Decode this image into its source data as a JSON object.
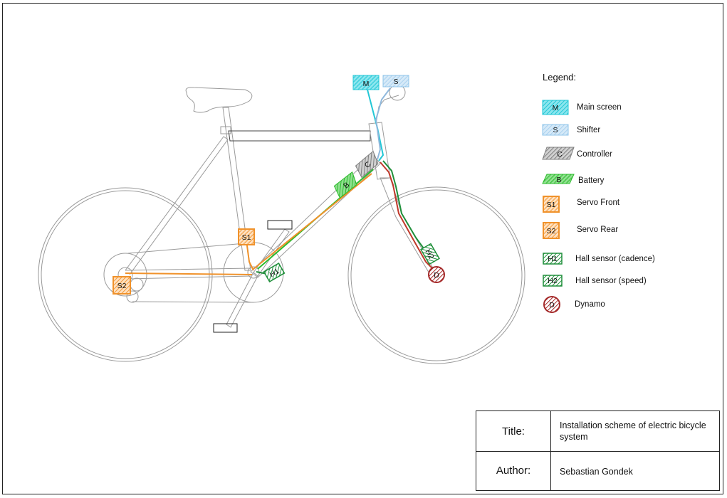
{
  "legend": {
    "title": "Legend:",
    "items": [
      {
        "code": "M",
        "label": "Main screen"
      },
      {
        "code": "S",
        "label": "Shifter"
      },
      {
        "code": "C",
        "label": "Controller"
      },
      {
        "code": "B",
        "label": "Battery"
      },
      {
        "code": "S1",
        "label": "Servo Front"
      },
      {
        "code": "S2",
        "label": "Servo Rear"
      },
      {
        "code": "H1",
        "label": "Hall sensor  (cadence)"
      },
      {
        "code": "H2",
        "label": "Hall sensor (speed)"
      },
      {
        "code": "D",
        "label": "Dynamo"
      }
    ]
  },
  "title_block": {
    "title_key": "Title:",
    "title_value": "Installation scheme of electric bicycle system",
    "author_key": "Author:",
    "author_value": "Sebastian Gondek"
  },
  "tags": {
    "main_screen": "M",
    "shifter": "S",
    "controller": "C",
    "battery": "B",
    "servo_front": "S1",
    "servo_rear": "S2",
    "hall_cadence": "H1",
    "hall_speed": "H2",
    "dynamo": "D"
  },
  "colors": {
    "main_screen": "#22c7d6",
    "shifter": "#8fc4ea",
    "controller": "#8c8c8c",
    "battery": "#2dbb2d",
    "servo": "#f0922b",
    "hall": "#1f8f3a",
    "dynamo": "#a52a2a",
    "wire_red": "#c0392b",
    "frame_line": "#9a9a9a"
  }
}
